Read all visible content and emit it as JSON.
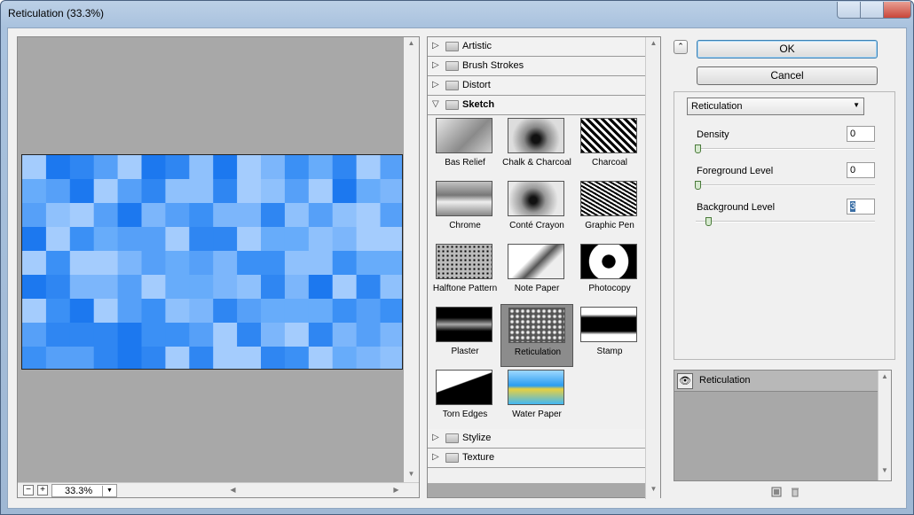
{
  "window": {
    "title": "Reticulation (33.3%)"
  },
  "preview": {
    "zoom": "33.3%",
    "zoom_out_label": "−",
    "zoom_in_label": "+",
    "tile_colors": [
      "#2f86f2",
      "#56a0f8",
      "#7cb6fb",
      "#a4ccfd",
      "#1c78ef",
      "#67acfa",
      "#3b90f5",
      "#8fc1fc"
    ]
  },
  "gallery": {
    "categories_top": [
      {
        "label": "Artistic"
      },
      {
        "label": "Brush Strokes"
      },
      {
        "label": "Distort"
      },
      {
        "label": "Sketch"
      }
    ],
    "categories_bottom": [
      {
        "label": "Stylize"
      },
      {
        "label": "Texture"
      }
    ],
    "thumbnails": [
      {
        "label": "Bas Relief"
      },
      {
        "label": "Chalk & Charcoal"
      },
      {
        "label": "Charcoal"
      },
      {
        "label": "Chrome"
      },
      {
        "label": "Conté Crayon"
      },
      {
        "label": "Graphic Pen"
      },
      {
        "label": "Halftone Pattern"
      },
      {
        "label": "Note Paper"
      },
      {
        "label": "Photocopy"
      },
      {
        "label": "Plaster"
      },
      {
        "label": "Reticulation"
      },
      {
        "label": "Stamp"
      },
      {
        "label": "Torn Edges"
      },
      {
        "label": "Water Paper"
      }
    ],
    "selected": "Reticulation"
  },
  "buttons": {
    "ok": "OK",
    "cancel": "Cancel"
  },
  "settings": {
    "filter_select": "Reticulation",
    "params": [
      {
        "label": "Density",
        "value": "0",
        "slider_fraction": 0
      },
      {
        "label": "Foreground Level",
        "value": "0",
        "slider_fraction": 0
      },
      {
        "label": "Background Level",
        "value": "3",
        "slider_fraction": 0.06
      }
    ]
  },
  "layers": {
    "items": [
      {
        "name": "Reticulation"
      }
    ]
  },
  "icons": {
    "eye": "eye-icon",
    "new_layer": "new-layer-icon",
    "delete_layer": "trash-icon",
    "collapse": "double-chevron-up-icon"
  }
}
